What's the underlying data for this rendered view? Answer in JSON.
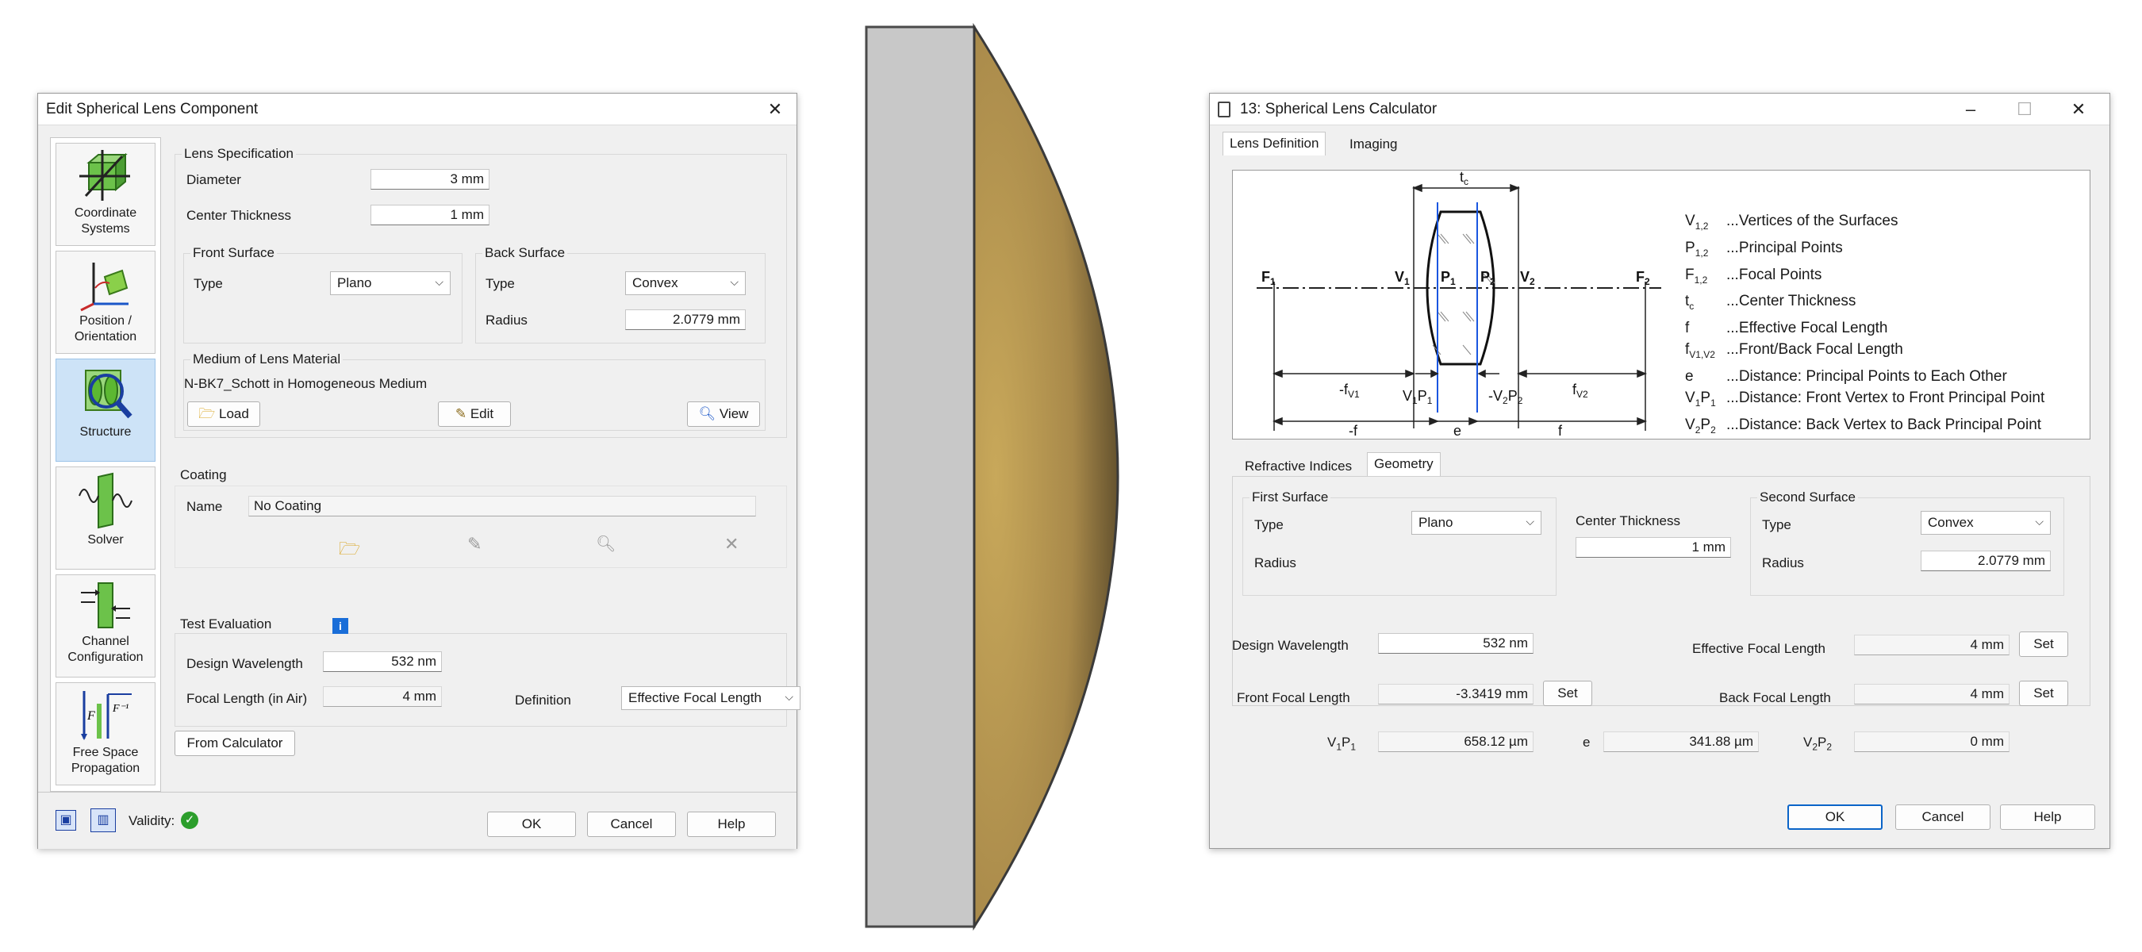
{
  "left_dialog": {
    "title": "Edit Spherical Lens Component",
    "sidebar": [
      {
        "label": "Coordinate Systems",
        "icon": "coordinate-systems-icon"
      },
      {
        "label": "Position / Orientation",
        "icon": "position-orientation-icon"
      },
      {
        "label": "Structure",
        "icon": "structure-icon"
      },
      {
        "label": "Solver",
        "icon": "solver-icon"
      },
      {
        "label": "Channel Configuration",
        "icon": "channel-configuration-icon"
      },
      {
        "label": "Free Space Propagation",
        "icon": "free-space-propagation-icon"
      }
    ],
    "lens_spec": {
      "title": "Lens Specification",
      "diameter_label": "Diameter",
      "diameter_value": "3 mm",
      "thickness_label": "Center Thickness",
      "thickness_value": "1 mm"
    },
    "front_surface": {
      "title": "Front Surface",
      "type_label": "Type",
      "type_value": "Plano"
    },
    "back_surface": {
      "title": "Back Surface",
      "type_label": "Type",
      "type_value": "Convex",
      "radius_label": "Radius",
      "radius_value": "2.0779 mm"
    },
    "medium": {
      "title": "Medium of Lens Material",
      "name": "N-BK7_Schott in Homogeneous Medium",
      "load_label": "Load",
      "edit_label": "Edit",
      "view_label": "View"
    },
    "coating": {
      "title": "Coating",
      "name_label": "Name",
      "name_value": "No Coating"
    },
    "test_eval": {
      "title": "Test Evaluation",
      "wavelength_label": "Design Wavelength",
      "wavelength_value": "532 nm",
      "focal_label": "Focal Length (in Air)",
      "focal_value": "4 mm",
      "definition_label": "Definition",
      "definition_value": "Effective Focal Length"
    },
    "from_calculator_label": "From Calculator",
    "validity_label": "Validity:",
    "ok_label": "OK",
    "cancel_label": "Cancel",
    "help_label": "Help"
  },
  "right_dialog": {
    "title": "13: Spherical Lens Calculator",
    "tabs": [
      "Lens Definition",
      "Imaging"
    ],
    "diagram": {
      "labels": {
        "tc": "t",
        "tc_sub": "c",
        "F1": "F",
        "F1_sub": "1",
        "F2": "F",
        "F2_sub": "2",
        "V1": "V",
        "V1_sub": "1",
        "V2": "V",
        "V2_sub": "2",
        "P1": "P",
        "P1_sub": "1",
        "P2": "P",
        "P2_sub": "2",
        "fv1": "-f",
        "fv1_sub": "V1",
        "fv2": "f",
        "fv2_sub": "V2",
        "v1p1_a": "V",
        "v1p1_a_sub": "1",
        "v1p1_b": "P",
        "v1p1_b_sub": "1",
        "v2p2_a": "-V",
        "v2p2_a_sub": "2",
        "v2p2_b": "P",
        "v2p2_b_sub": "2",
        "neg_f": "-f",
        "e": "e",
        "f": "f"
      },
      "legend": [
        {
          "sym": "V",
          "sub": "1,2",
          "desc": "...Vertices of the Surfaces"
        },
        {
          "sym": "P",
          "sub": "1,2",
          "desc": "...Principal Points"
        },
        {
          "sym": "F",
          "sub": "1,2",
          "desc": "...Focal Points"
        },
        {
          "sym": "t",
          "sub": "c",
          "desc": "...Center Thickness"
        },
        {
          "sym": "f",
          "sub": "",
          "desc": "...Effective Focal Length"
        },
        {
          "sym": "f",
          "sub": "V1,V2",
          "desc": "...Front/Back Focal Length"
        },
        {
          "sym": "e",
          "sub": "",
          "desc": "...Distance: Principal Points to Each Other"
        },
        {
          "sym": "V",
          "sub": "1",
          "sym2": "P",
          "sub2": "1",
          "desc": "...Distance: Front Vertex to Front Principal Point"
        },
        {
          "sym": "V",
          "sub": "2",
          "sym2": "P",
          "sub2": "2",
          "desc": "...Distance: Back Vertex to Back Principal Point"
        }
      ]
    },
    "subtabs": [
      "Refractive Indices",
      "Geometry"
    ],
    "first_surface": {
      "title": "First Surface",
      "type_label": "Type",
      "type_value": "Plano",
      "radius_label": "Radius"
    },
    "center_thickness": {
      "label": "Center Thickness",
      "value": "1 mm"
    },
    "second_surface": {
      "title": "Second Surface",
      "type_label": "Type",
      "type_value": "Convex",
      "radius_label": "Radius",
      "radius_value": "2.0779 mm"
    },
    "design_wavelength": {
      "label": "Design Wavelength",
      "value": "532 nm"
    },
    "effective_focal_length": {
      "label": "Effective Focal Length",
      "value": "4 mm"
    },
    "front_focal_length": {
      "label": "Front Focal Length",
      "value": "-3.3419 mm"
    },
    "back_focal_length": {
      "label": "Back Focal Length",
      "value": "4 mm"
    },
    "v1p1": {
      "a": "V",
      "a_sub": "1",
      "b": "P",
      "b_sub": "1",
      "value": "658.12 µm"
    },
    "e": {
      "label": "e",
      "value": "341.88 µm"
    },
    "v2p2": {
      "a": "V",
      "a_sub": "2",
      "b": "P",
      "b_sub": "2",
      "value": "0 mm"
    },
    "set_label": "Set",
    "ok_label": "OK",
    "cancel_label": "Cancel",
    "help_label": "Help"
  },
  "colors": {
    "accent": "#0a64c8",
    "lens_gold": "#c8a85a",
    "plate_gray": "#c8c8c8"
  }
}
